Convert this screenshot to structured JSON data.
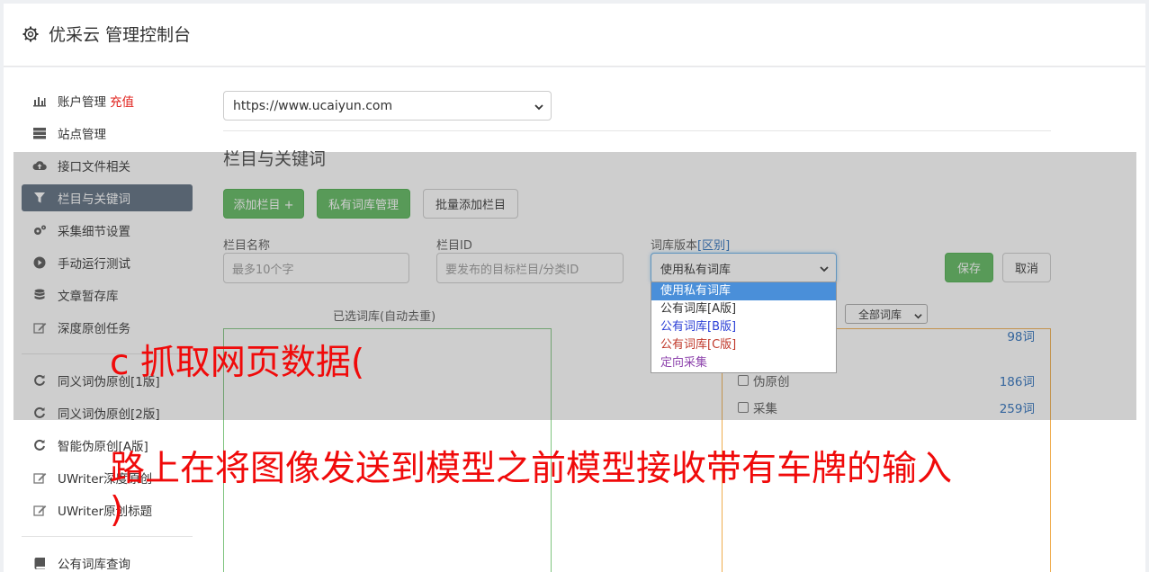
{
  "header": {
    "title": "优采云 管理控制台"
  },
  "sidebar": {
    "items": [
      {
        "label": "账户管理",
        "extra": "充值",
        "icon": "bar-chart-icon"
      },
      {
        "label": "站点管理",
        "icon": "server-icon"
      },
      {
        "label": "接口文件相关",
        "icon": "cloud-upload-icon"
      },
      {
        "label": "栏目与关键词",
        "icon": "filter-icon",
        "active": true
      },
      {
        "label": "采集细节设置",
        "icon": "cogs-icon"
      },
      {
        "label": "手动运行测试",
        "icon": "play-circle-icon"
      },
      {
        "label": "文章暂存库",
        "icon": "database-icon"
      },
      {
        "label": "深度原创任务",
        "icon": "edit-icon"
      },
      {
        "label": "同义词伪原创[1版]",
        "icon": "refresh-icon"
      },
      {
        "label": "同义词伪原创[2版]",
        "icon": "refresh-icon"
      },
      {
        "label": "智能伪原创[A版]",
        "icon": "refresh-icon"
      },
      {
        "label": "UWriter深度原创",
        "icon": "edit-icon"
      },
      {
        "label": "UWriter原创标题",
        "icon": "edit-icon"
      },
      {
        "label": "公有词库查询",
        "icon": "book-icon"
      }
    ]
  },
  "main": {
    "site_select": "https://www.ucaiyun.com",
    "section_title": "栏目与关键词",
    "buttons": {
      "add_column": "添加栏目 +",
      "private_lib": "私有词库管理",
      "batch_add": "批量添加栏目",
      "save": "保存",
      "cancel": "取消"
    },
    "fields": {
      "name_label": "栏目名称",
      "name_placeholder": "最多10个字",
      "id_label": "栏目ID",
      "id_placeholder": "要发布的目标栏目/分类ID",
      "lib_label": "词库版本",
      "lib_label_link": "[区别]",
      "lib_value": "使用私有词库"
    },
    "dropdown_options": [
      {
        "label": "使用私有词库",
        "selected": true,
        "color": "#ffffff"
      },
      {
        "label": "公有词库[A版]",
        "color": "#333333"
      },
      {
        "label": "公有词库[B版]",
        "color": "#2b3fd6"
      },
      {
        "label": "公有词库[C版]",
        "color": "#c0392b"
      },
      {
        "label": "定向采集",
        "color": "#8e44ad"
      }
    ],
    "selected_caption": "已选词库(自动去重)",
    "all_lib_select": "全部词库",
    "libraries": [
      {
        "label": "",
        "count": "98词"
      },
      {
        "label": "伪原创",
        "count": "186词"
      },
      {
        "label": "采集",
        "count": "259词"
      }
    ]
  },
  "watermark": {
    "line1": "c 抓取网页数据(",
    "line2": "路上在将图像发送到模型之前模型接收带有车牌的输入",
    "line3": ")"
  }
}
